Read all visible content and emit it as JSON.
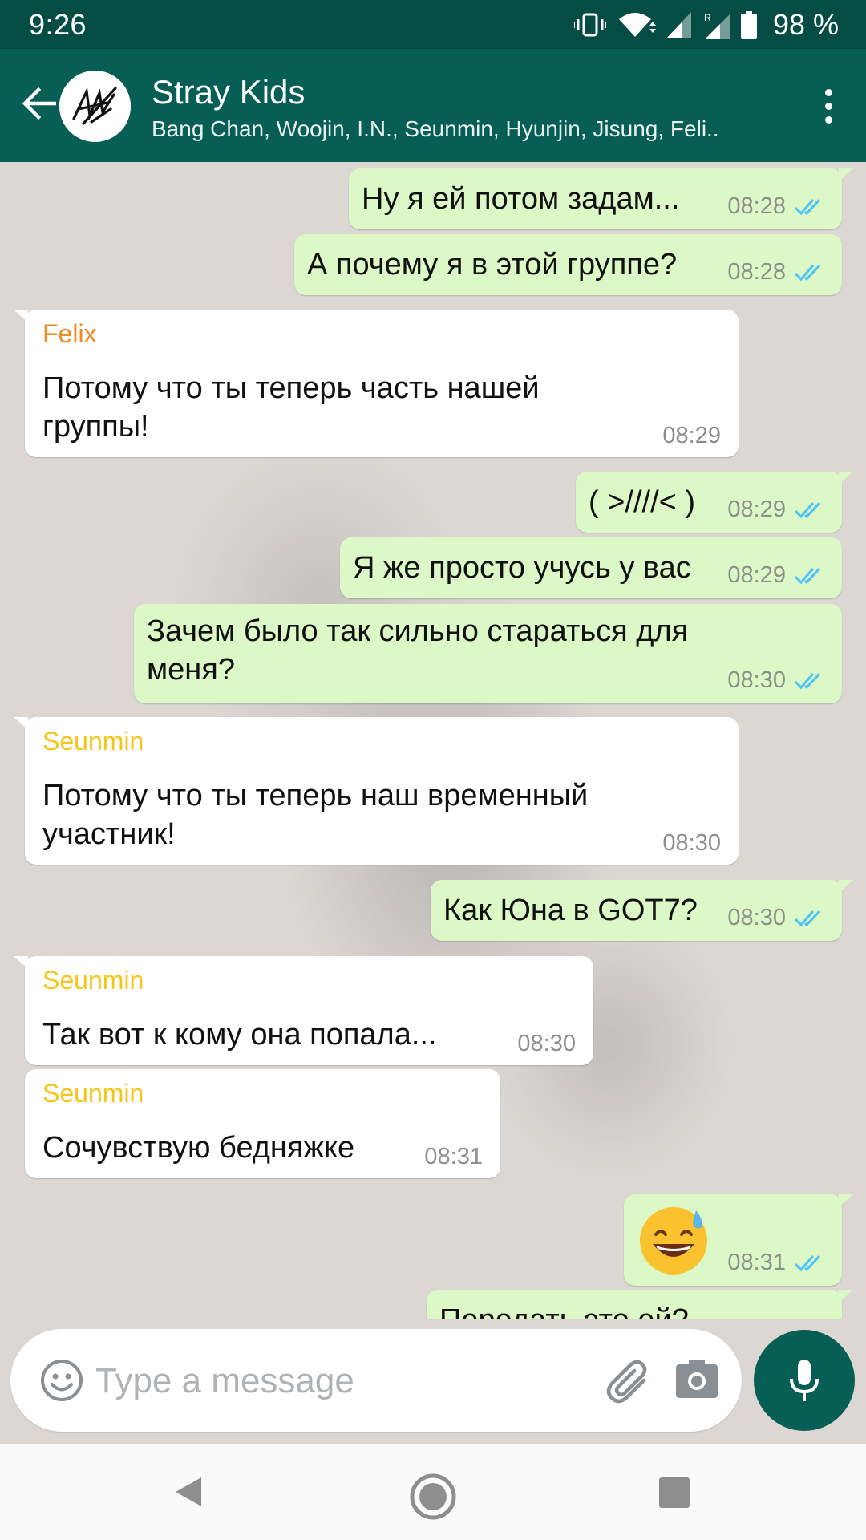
{
  "status_bar": {
    "time": "9:26",
    "battery": "98 %",
    "icons": [
      "vibrate-icon",
      "wifi-icon",
      "signal-icon",
      "signal-roaming-icon",
      "battery-icon"
    ]
  },
  "header": {
    "title": "Stray Kids",
    "subtitle": "Bang Chan, Woojin, I.N., Seunmin, Hyunjin, Jisung, Feli..",
    "back_icon": "arrow-left-icon",
    "menu_icon": "more-vertical-icon"
  },
  "colors": {
    "header_bg": "#075e54",
    "status_bg": "#054d44",
    "outgoing_bubble": "#dcf8c6",
    "incoming_bubble": "#ffffff",
    "read_ticks": "#4fc3f7",
    "sender_felix": "#f08a24",
    "sender_seunmin": "#f5c518",
    "chat_bg": "#ddd7d4"
  },
  "messages": [
    {
      "dir": "out",
      "text": "Ну я ей потом задам...",
      "time": "08:28"
    },
    {
      "dir": "out",
      "text": "А почему я в этой группе?",
      "time": "08:28"
    },
    {
      "dir": "in",
      "sender": "Felix",
      "text": "Потому что ты теперь часть нашей группы!",
      "time": "08:29"
    },
    {
      "dir": "out",
      "text": "( >////< )",
      "time": "08:29"
    },
    {
      "dir": "out",
      "text": "Я же просто учусь у вас",
      "time": "08:29"
    },
    {
      "dir": "out",
      "text": "Зачем было так сильно стараться для меня?",
      "time": "08:30"
    },
    {
      "dir": "in",
      "sender": "Seunmin",
      "text": "Потому что ты теперь наш временный участник!",
      "time": "08:30"
    },
    {
      "dir": "out",
      "text": "Как Юна в GOT7?",
      "time": "08:30"
    },
    {
      "dir": "in",
      "sender": "Seunmin",
      "text": "Так вот к кому она попала...",
      "time": "08:30"
    },
    {
      "dir": "in",
      "sender": "Seunmin",
      "text": "Сочувствую бедняжке",
      "time": "08:31"
    },
    {
      "dir": "out",
      "text": "😅",
      "time": "08:31"
    },
    {
      "dir": "out",
      "text": "Передать это ей?",
      "time": ""
    }
  ],
  "input": {
    "placeholder": "Type a message",
    "emoji_icon": "emoji-icon",
    "attach_icon": "paperclip-icon",
    "camera_icon": "camera-icon",
    "mic_icon": "microphone-icon"
  },
  "nav": {
    "back_icon": "nav-back-icon",
    "home_icon": "nav-home-icon",
    "recents_icon": "nav-recents-icon"
  }
}
